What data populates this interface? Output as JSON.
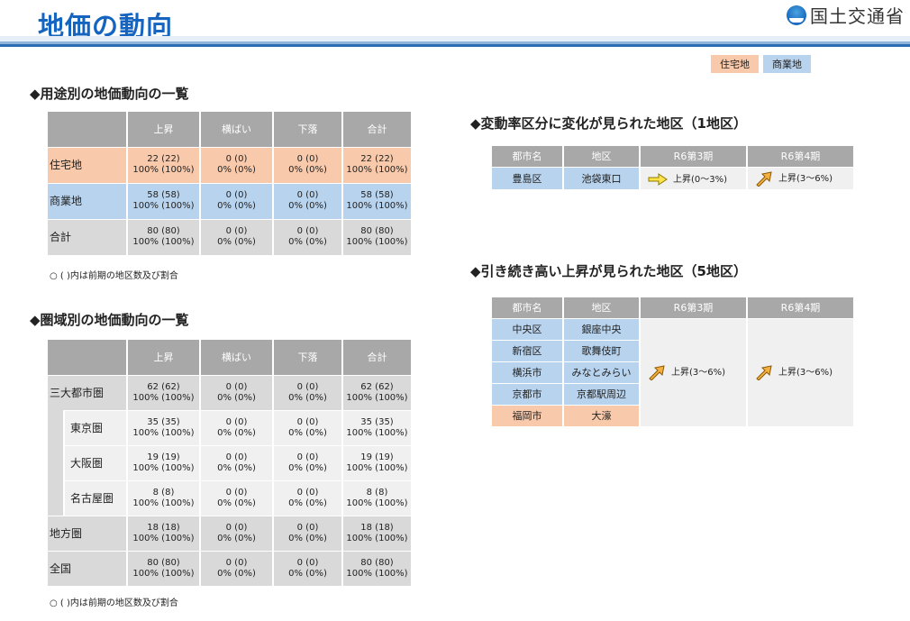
{
  "header": {
    "title": "地価の動向",
    "ministry": "国土交通省"
  },
  "legend": {
    "residential": "住宅地",
    "commercial": "商業地"
  },
  "colors": {
    "residential": "#f8c9aa",
    "commercial": "#b8d3ee",
    "header_gray": "#a8a8a8",
    "title_blue": "#1565c0"
  },
  "usage_section": {
    "title": "◆用途別の地価動向の一覧",
    "headers": [
      "",
      "上昇",
      "横ばい",
      "下落",
      "合計"
    ],
    "rows": [
      {
        "label": "住宅地",
        "cells": [
          [
            "22 (22)",
            "100% (100%)"
          ],
          [
            "0 (0)",
            "0% (0%)"
          ],
          [
            "0 (0)",
            "0% (0%)"
          ],
          [
            "22 (22)",
            "100% (100%)"
          ]
        ]
      },
      {
        "label": "商業地",
        "cells": [
          [
            "58 (58)",
            "100% (100%)"
          ],
          [
            "0 (0)",
            "0% (0%)"
          ],
          [
            "0 (0)",
            "0% (0%)"
          ],
          [
            "58 (58)",
            "100% (100%)"
          ]
        ]
      },
      {
        "label": "合計",
        "cells": [
          [
            "80 (80)",
            "100% (100%)"
          ],
          [
            "0 (0)",
            "0% (0%)"
          ],
          [
            "0 (0)",
            "0% (0%)"
          ],
          [
            "80 (80)",
            "100% (100%)"
          ]
        ]
      }
    ],
    "note": "○ ( )内は前期の地区数及び割合"
  },
  "region_section": {
    "title": "◆圏域別の地価動向の一覧",
    "headers": [
      "",
      "上昇",
      "横ばい",
      "下落",
      "合計"
    ],
    "rows": [
      {
        "label": "三大都市圏",
        "cells": [
          [
            "62 (62)",
            "100% (100%)"
          ],
          [
            "0 (0)",
            "0% (0%)"
          ],
          [
            "0 (0)",
            "0% (0%)"
          ],
          [
            "62 (62)",
            "100% (100%)"
          ]
        ]
      },
      {
        "label": "東京圏",
        "cells": [
          [
            "35 (35)",
            "100% (100%)"
          ],
          [
            "0 (0)",
            "0% (0%)"
          ],
          [
            "0 (0)",
            "0% (0%)"
          ],
          [
            "35 (35)",
            "100% (100%)"
          ]
        ]
      },
      {
        "label": "大阪圏",
        "cells": [
          [
            "19 (19)",
            "100% (100%)"
          ],
          [
            "0 (0)",
            "0% (0%)"
          ],
          [
            "0 (0)",
            "0% (0%)"
          ],
          [
            "19 (19)",
            "100% (100%)"
          ]
        ]
      },
      {
        "label": "名古屋圏",
        "cells": [
          [
            "8 (8)",
            "100% (100%)"
          ],
          [
            "0 (0)",
            "0% (0%)"
          ],
          [
            "0 (0)",
            "0% (0%)"
          ],
          [
            "8 (8)",
            "100% (100%)"
          ]
        ]
      },
      {
        "label": "地方圏",
        "cells": [
          [
            "18 (18)",
            "100% (100%)"
          ],
          [
            "0 (0)",
            "0% (0%)"
          ],
          [
            "0 (0)",
            "0% (0%)"
          ],
          [
            "18 (18)",
            "100% (100%)"
          ]
        ]
      },
      {
        "label": "全国",
        "cells": [
          [
            "80 (80)",
            "100% (100%)"
          ],
          [
            "0 (0)",
            "0% (0%)"
          ],
          [
            "0 (0)",
            "0% (0%)"
          ],
          [
            "80 (80)",
            "100% (100%)"
          ]
        ]
      }
    ],
    "note": "○ ( )内は前期の地区数及び割合"
  },
  "change_section": {
    "title": "◆変動率区分に変化が見られた地区（1地区）",
    "headers": [
      "都市名",
      "地区",
      "R6第3期",
      "R6第4期"
    ],
    "rows": [
      {
        "city": "豊島区",
        "area": "池袋東口",
        "q3": "上昇(0～3%)",
        "q4": "上昇(3～6%)"
      }
    ]
  },
  "high_section": {
    "title": "◆引き続き高い上昇が見られた地区（5地区）",
    "headers": [
      "都市名",
      "地区",
      "R6第3期",
      "R6第4期"
    ],
    "rows": [
      {
        "city": "中央区",
        "area": "銀座中央"
      },
      {
        "city": "新宿区",
        "area": "歌舞伎町"
      },
      {
        "city": "横浜市",
        "area": "みなとみらい"
      },
      {
        "city": "京都市",
        "area": "京都駅周辺"
      },
      {
        "city": "福岡市",
        "area": "大濠"
      }
    ],
    "q3": "上昇(3～6%)",
    "q4": "上昇(3～6%)"
  }
}
